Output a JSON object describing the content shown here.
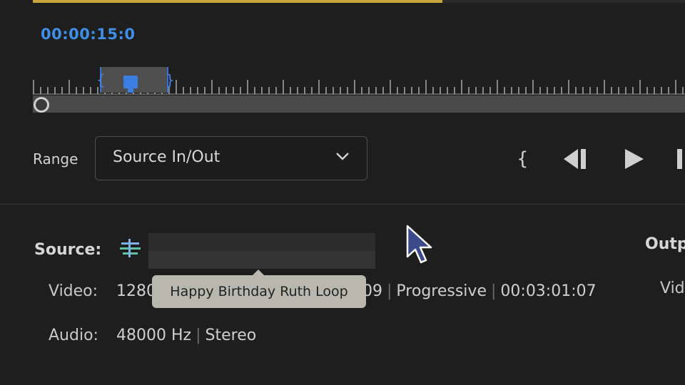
{
  "preview": {
    "timecode": "00:00:15:0"
  },
  "controls": {
    "range_label": "Range",
    "range_value": "Source In/Out",
    "icons": [
      "in-point-icon",
      "step-back-icon",
      "play-icon",
      "step-forward-icon"
    ]
  },
  "source": {
    "label": "Source:",
    "tooltip": "Happy Birthday Ruth Loop",
    "video_label": "Video:",
    "video_value": "1280",
    "video_suffix": "09",
    "video_scan": "Progressive",
    "video_duration": "00:03:01:07",
    "audio_label": "Audio:",
    "audio_rate": "48000 Hz",
    "audio_channels": "Stereo"
  },
  "output": {
    "label": "Outp",
    "video_label": "Vid"
  },
  "colors": {
    "accent": "#3f8ee8",
    "background": "#1e1e1e",
    "tooltip": "#b8b8ae"
  }
}
